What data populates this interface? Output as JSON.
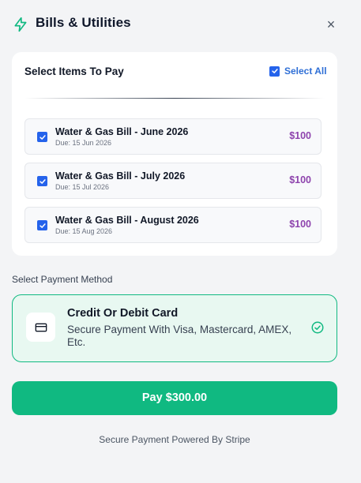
{
  "header": {
    "title": "Bills & Utilities",
    "icon": "lightning-bolt-icon",
    "close_icon": "×",
    "accent_color": "#10b981"
  },
  "items": {
    "title": "Select Items To Pay",
    "select_all_label": "Select All",
    "select_all_checked": true,
    "bills": [
      {
        "name": "Water & Gas Bill - June 2026",
        "due": "Due: 15 Jun 2026",
        "amount": "$100",
        "checked": true
      },
      {
        "name": "Water & Gas Bill - July 2026",
        "due": "Due: 15 Jul 2026",
        "amount": "$100",
        "checked": true
      },
      {
        "name": "Water & Gas Bill - August 2026",
        "due": "Due: 15 Aug 2026",
        "amount": "$100",
        "checked": true
      }
    ]
  },
  "payment": {
    "section_label": "Select Payment Method",
    "method_title": "Credit Or Debit Card",
    "method_desc": "Secure Payment With Visa, Mastercard, AMEX, Etc.",
    "method_icon": "credit-card-icon",
    "selected": true
  },
  "pay_button_label": "Pay $300.00",
  "footer_note": "Secure Payment Powered By Stripe"
}
